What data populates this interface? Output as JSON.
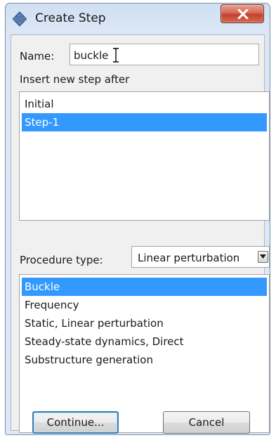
{
  "window": {
    "title": "Create Step",
    "icons": {
      "app": "create-step-icon",
      "close": "close-icon"
    }
  },
  "form": {
    "name_label": "Name:",
    "name_value": "buckle",
    "insert_label": "Insert new step after",
    "steps": [
      {
        "label": "Initial",
        "selected": false
      },
      {
        "label": "Step-1",
        "selected": true
      }
    ],
    "procedure_label": "Procedure type:",
    "procedure_selected": "Linear perturbation",
    "procedures": [
      {
        "label": "Buckle",
        "selected": true
      },
      {
        "label": "Frequency",
        "selected": false
      },
      {
        "label": "Static, Linear perturbation",
        "selected": false
      },
      {
        "label": "Steady-state dynamics, Direct",
        "selected": false
      },
      {
        "label": "Substructure generation",
        "selected": false
      }
    ]
  },
  "buttons": {
    "continue": "Continue...",
    "cancel": "Cancel"
  },
  "colors": {
    "selection": "#3399ff",
    "close_button": "#c9442f",
    "default_button_border": "#3c7fb1"
  }
}
